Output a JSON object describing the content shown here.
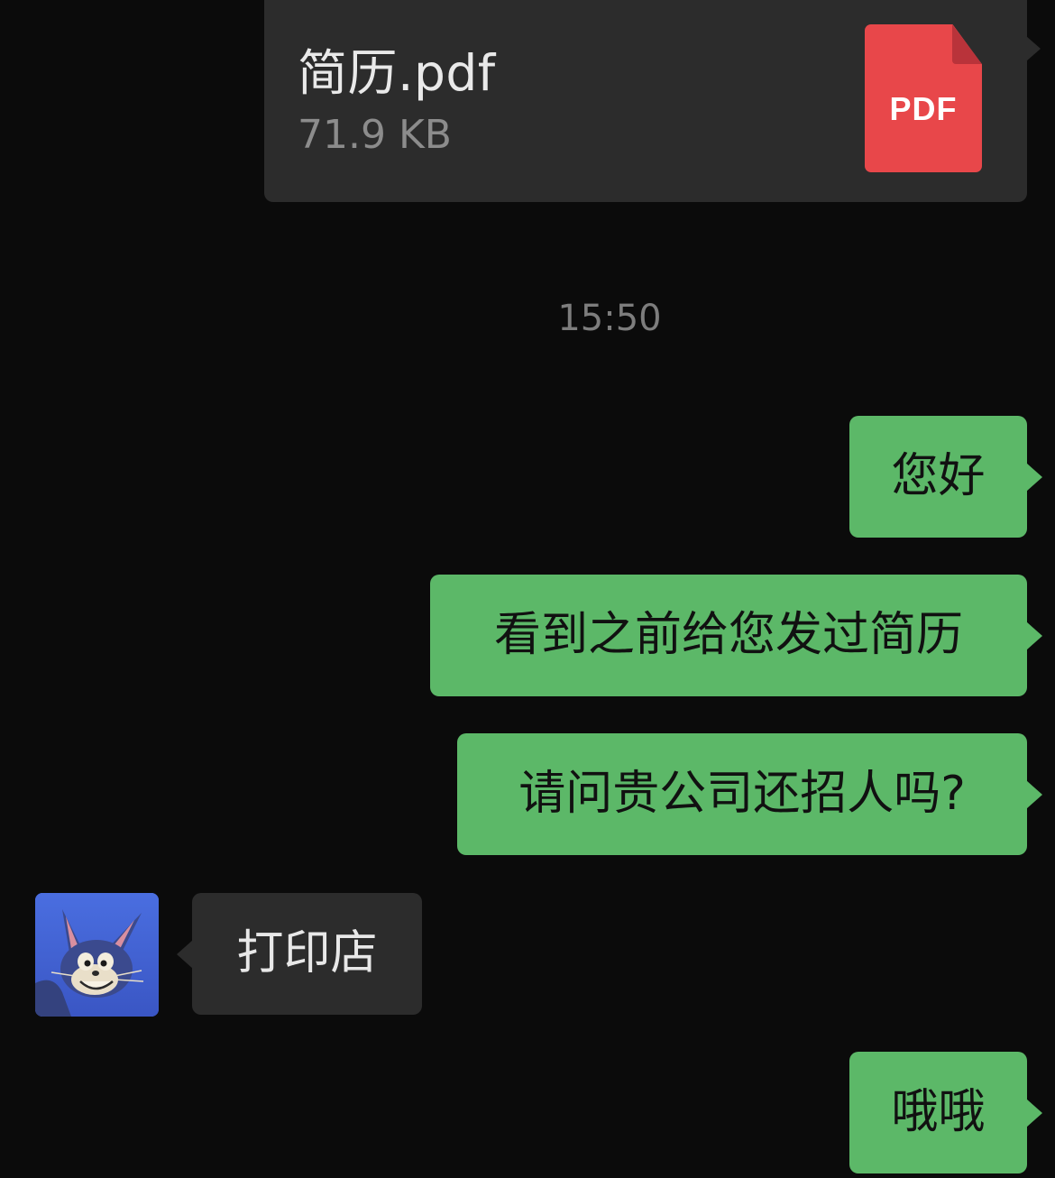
{
  "file_message": {
    "name": "简历.pdf",
    "size": "71.9 KB",
    "icon": "pdf-file-icon",
    "icon_label": "PDF",
    "icon_color": "#e8474a"
  },
  "timestamp": "15:50",
  "messages": [
    {
      "direction": "out",
      "text": "您好"
    },
    {
      "direction": "out",
      "text": "看到之前给您发过简历"
    },
    {
      "direction": "out",
      "text": "请问贵公司还招人吗?"
    },
    {
      "direction": "in",
      "text": "打印店",
      "avatar": "cartoon-cat-avatar"
    },
    {
      "direction": "out",
      "text": "哦哦"
    }
  ],
  "colors": {
    "background": "#0b0b0b",
    "outgoing_bubble": "#5cb868",
    "incoming_bubble": "#2c2c2c",
    "timestamp_text": "#7d7d7d"
  }
}
